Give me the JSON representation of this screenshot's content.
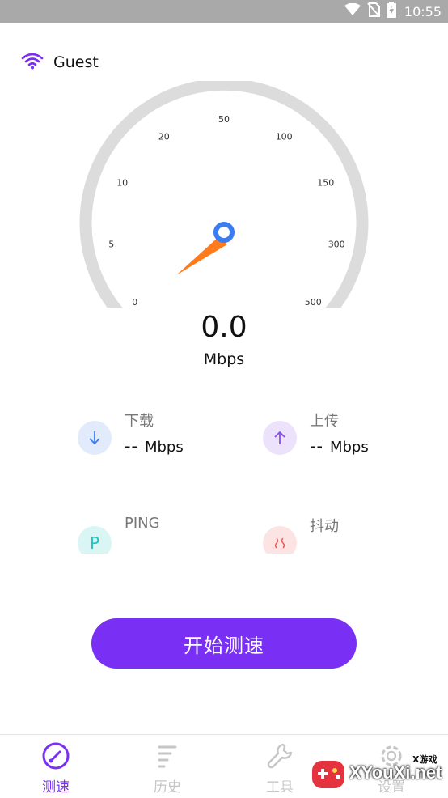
{
  "status_bar": {
    "time": "10:55",
    "icons": [
      "wifi-icon",
      "no-sim-icon",
      "battery-charging-icon"
    ]
  },
  "network": {
    "name": "Guest",
    "icon": "wifi-icon",
    "color": "#7a2ff5"
  },
  "gauge": {
    "ticks": [
      "0",
      "5",
      "10",
      "20",
      "50",
      "100",
      "150",
      "300",
      "500"
    ],
    "value": "0.0",
    "unit": "Mbps",
    "needle_value": 0
  },
  "metrics": {
    "download": {
      "label": "下载",
      "value": "--",
      "unit": "Mbps",
      "icon": "arrow-down-icon",
      "color": "#3b7df0"
    },
    "upload": {
      "label": "上传",
      "value": "--",
      "unit": "Mbps",
      "icon": "arrow-up-icon",
      "color": "#8a4de8"
    },
    "ping": {
      "label": "PING",
      "icon": "ping-icon",
      "icon_text": "P",
      "color": "#27c2c0"
    },
    "jitter": {
      "label": "抖动",
      "icon": "jitter-icon",
      "color": "#f05a5a"
    }
  },
  "start_button": {
    "label": "开始测速",
    "color": "#7a2ff5"
  },
  "bottom_nav": {
    "items": [
      {
        "label": "测速",
        "icon": "speedometer-icon",
        "active": true
      },
      {
        "label": "历史",
        "icon": "history-list-icon",
        "active": false
      },
      {
        "label": "工具",
        "icon": "wrench-icon",
        "active": false
      },
      {
        "label": "设置",
        "icon": "gear-icon",
        "active": false
      }
    ]
  },
  "watermark": {
    "text": "XYouXi.net",
    "small": "X游戏"
  }
}
